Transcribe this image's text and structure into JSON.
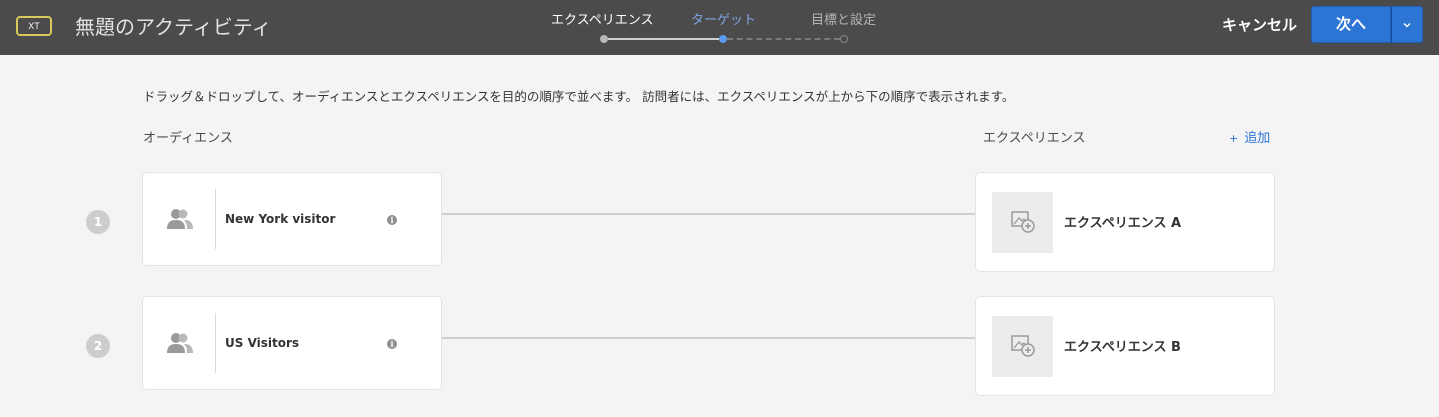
{
  "header": {
    "badge": "XT",
    "title": "無題のアクティビティ",
    "steps": [
      {
        "label": "エクスペリエンス",
        "state": "completed"
      },
      {
        "label": "ターゲット",
        "state": "active"
      },
      {
        "label": "目標と設定",
        "state": "pending"
      }
    ],
    "cancel_label": "キャンセル",
    "next_label": "次へ",
    "next_dropdown_icon": "chevron-down-icon"
  },
  "main": {
    "instructions": "ドラッグ＆ドロップして、オーディエンスとエクスペリエンスを目的の順序で並べます。 訪問者には、エクスペリエンスが上から下の順序で表示されます。",
    "audience_header": "オーディエンス",
    "experience_header": "エクスペリエンス",
    "add_label": "追加",
    "add_icon": "+",
    "rows": [
      {
        "number": "1",
        "audience": "New York visitor",
        "experience": "エクスペリエンス A"
      },
      {
        "number": "2",
        "audience": "US Visitors",
        "experience": "エクスペリエンス B"
      }
    ]
  },
  "colors": {
    "header_bg": "#4b4b4b",
    "accent": "#2d75d4",
    "active_step": "#7fa8e8",
    "badge_border": "#d8c95a",
    "page_bg": "#f4f4f4"
  }
}
